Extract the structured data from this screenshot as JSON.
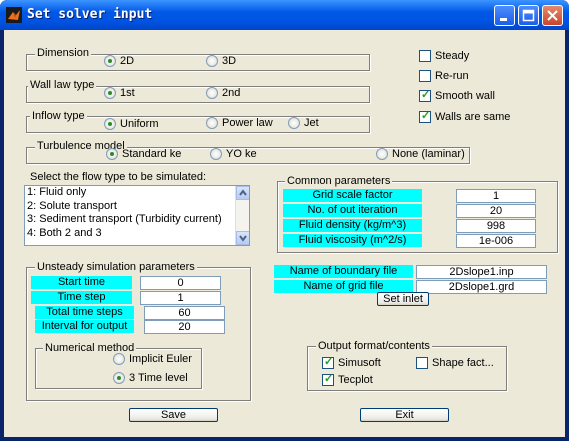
{
  "window": {
    "title": "Set solver input"
  },
  "dimension": {
    "legend": "Dimension",
    "options": [
      "2D",
      "3D"
    ],
    "selected": "2D"
  },
  "wall_law": {
    "legend": "Wall law type",
    "options": [
      "1st",
      "2nd"
    ],
    "selected": "1st"
  },
  "inflow": {
    "legend": "Inflow type",
    "options": [
      "Uniform",
      "Power law",
      "Jet"
    ],
    "selected": "Uniform"
  },
  "turbulence": {
    "legend": "Turbulence model",
    "options": [
      "Standard ke",
      "YO ke",
      "None (laminar)"
    ],
    "selected": "Standard ke"
  },
  "flags": [
    {
      "label": "Steady",
      "checked": false
    },
    {
      "label": "Re-run",
      "checked": false
    },
    {
      "label": "Smooth wall",
      "checked": true
    },
    {
      "label": "Walls are same",
      "checked": true
    }
  ],
  "flow_type": {
    "prompt": "Select the flow type to be simulated:",
    "items": [
      "1: Fluid only",
      "2: Solute transport",
      "3: Sediment transport (Turbidity current)",
      "4: Both 2 and 3"
    ]
  },
  "common": {
    "legend": "Common parameters",
    "rows": [
      {
        "label": "Grid scale factor",
        "value": "1"
      },
      {
        "label": "No. of out iteration",
        "value": "20"
      },
      {
        "label": "Fluid density (kg/m^3)",
        "value": "998"
      },
      {
        "label": "Fluid viscosity (m^2/s)",
        "value": "1e-006"
      }
    ]
  },
  "unsteady": {
    "legend": "Unsteady simulation parameters",
    "rows": [
      {
        "label": "Start time",
        "value": "0"
      },
      {
        "label": "Time step",
        "value": "1"
      },
      {
        "label": "Total time steps",
        "value": "60"
      },
      {
        "label": "Interval for output",
        "value": "20"
      }
    ]
  },
  "numerical": {
    "legend": "Numerical method",
    "options": [
      "Implicit Euler",
      "3 Time level"
    ],
    "selected": "3 Time level"
  },
  "inlet": {
    "boundary_label": "Name of boundary file",
    "boundary_value": "2Dslope1.inp",
    "grid_label": "Name of grid file",
    "grid_value": "2Dslope1.grd",
    "set_inlet": "Set inlet"
  },
  "output": {
    "legend": "Output format/contents",
    "items": [
      {
        "label": "Simusoft",
        "checked": true
      },
      {
        "label": "Shape fact...",
        "checked": false
      },
      {
        "label": "Tecplot",
        "checked": true
      }
    ]
  },
  "buttons": {
    "save": "Save",
    "exit": "Exit"
  }
}
